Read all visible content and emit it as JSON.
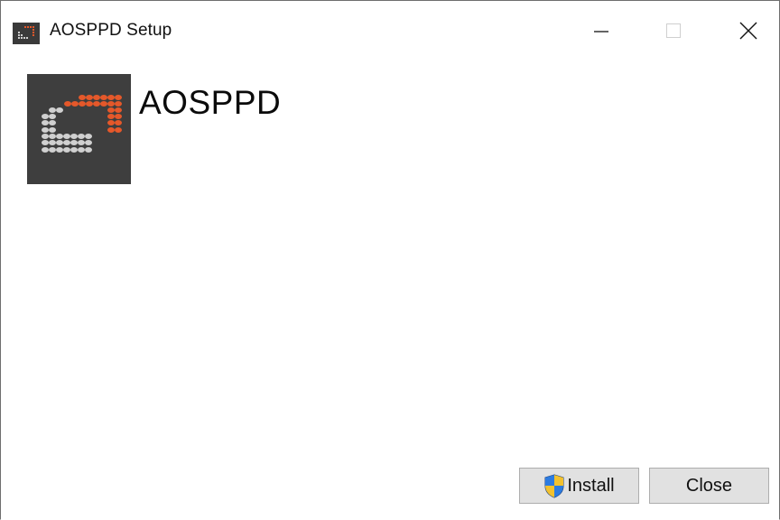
{
  "window": {
    "title": "AOSPPD Setup",
    "controls": {
      "minimize_icon": "minimize-icon",
      "maximize_icon": "maximize-icon",
      "close_icon": "close-icon"
    }
  },
  "app": {
    "name": "AOSPPD",
    "logo_icon": "aosppd-logo",
    "logo_colors": {
      "background": "#3e3e3e",
      "accent": "#e5582a",
      "dots": "#d0d0d0"
    }
  },
  "buttons": {
    "install_label": "Install",
    "install_icon": "uac-shield-icon",
    "close_label": "Close"
  }
}
